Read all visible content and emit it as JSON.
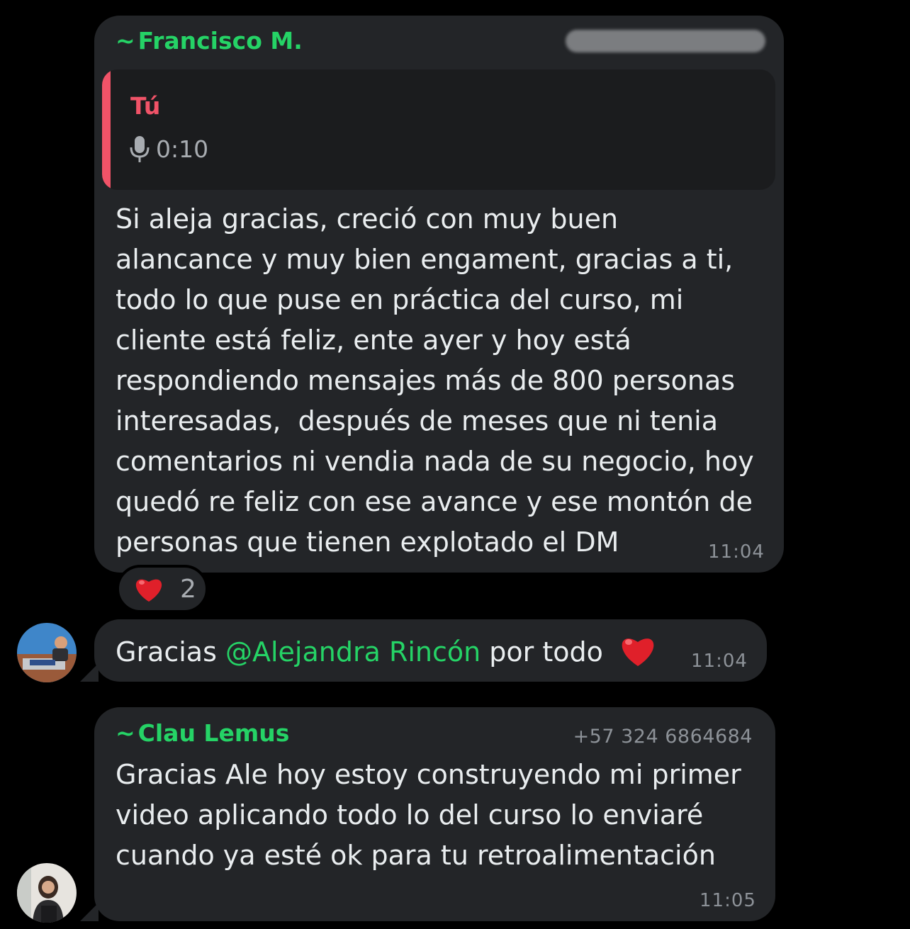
{
  "colors": {
    "background": "#000000",
    "bubble": "#232528",
    "sender_name": "#25d366",
    "quote_accent": "#f15368",
    "text": "#e9edef",
    "meta": "#8d9298"
  },
  "messages": [
    {
      "sender_prefix": "~",
      "sender": "Francisco M.",
      "phone_redacted": true,
      "quote": {
        "author": "Tú",
        "icon": "mic-icon",
        "voice_duration": "0:10"
      },
      "text": "Si aleja gracias, creció con muy buen\nalancance y muy bien engament, gracias a ti,\ntodo lo que puse en práctica del curso, mi\ncliente está feliz, ente ayer y hoy está\nrespondiendo mensajes más de 800 personas\ninteresadas,  después de meses que ni tenia\ncomentarios ni vendia nada de su negocio, hoy\nquedó re feliz con ese avance y ese montón de\npersonas que tienen explotado el DM",
      "time": "11:04",
      "reaction": {
        "icon": "red-heart-icon",
        "count": "2"
      }
    },
    {
      "text_before": "Gracias ",
      "mention": "@Alejandra Rincón",
      "text_after": " por todo ",
      "emoji": "red-heart-icon",
      "time": "11:04",
      "avatar": "avatar-man-sitting"
    },
    {
      "sender_prefix": "~",
      "sender": "Clau Lemus",
      "phone": "+57 324 6864684",
      "text": "Gracias Ale hoy estoy construyendo mi primer\nvideo aplicando todo lo del curso lo enviaré\ncuando ya esté ok para tu retroalimentación",
      "time": "11:05",
      "avatar": "avatar-woman"
    }
  ]
}
